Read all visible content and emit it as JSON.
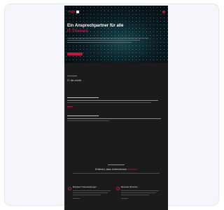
{
  "hero": {
    "logo": "mps",
    "title": "Ein Ansprechpartner für alle",
    "title_highlight": "IT-Themen"
  },
  "section1": {
    "heading": "IT, die zuhört",
    "heading_highlight": "..."
  },
  "section2": {
    "title": "Erfahren, dass Unternehmen",
    "title_highlight": "wachsen"
  },
  "features": [
    {
      "title": "Modulare IT-Dienstleistungen"
    },
    {
      "title": "Maximale Sicherheit"
    }
  ],
  "colors": {
    "accent": "#c8143d",
    "background": "#1b1b1b"
  }
}
